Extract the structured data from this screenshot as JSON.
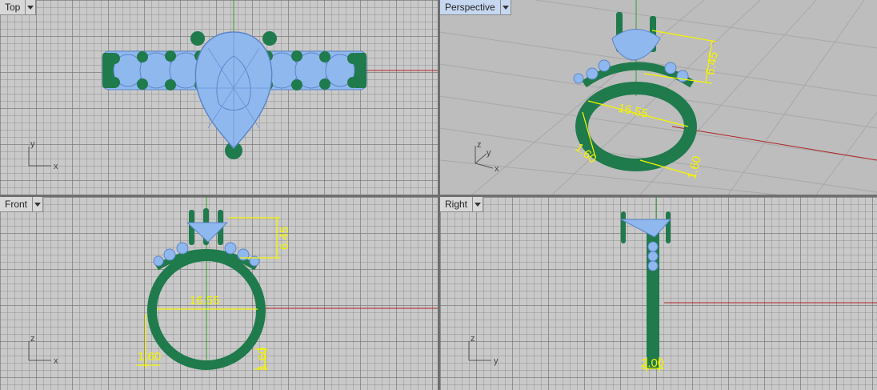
{
  "viewports": {
    "top": {
      "label": "Top",
      "axes": {
        "a": "y",
        "b": "x"
      }
    },
    "perspective": {
      "label": "Perspective",
      "axes": {
        "a": "z",
        "b": "y",
        "c": "x"
      },
      "dims": {
        "stone_height": "6.45",
        "inner_diameter": "16.55",
        "shank_width": "1.60",
        "shank_thickness": "1.60"
      }
    },
    "front": {
      "label": "Front",
      "axes": {
        "a": "z",
        "b": "x"
      },
      "dims": {
        "stone_height": "6.45",
        "inner_diameter": "16.55",
        "shank_width": "1.60",
        "shank_thickness": "1.60"
      }
    },
    "right": {
      "label": "Right",
      "axes": {
        "a": "z",
        "b": "y"
      },
      "dims": {
        "band_width": "2.00"
      }
    }
  },
  "colors": {
    "metal": "#1f7a4c",
    "gem": "#8fb8ef",
    "dimension": "#f4f400",
    "x_axis": "#b22222",
    "y_axis": "#2f9e2f"
  },
  "icons": {
    "viewport_menu": "dropdown-arrow-icon"
  }
}
